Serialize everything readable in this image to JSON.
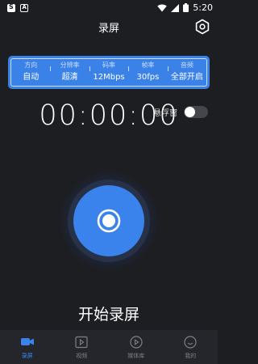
{
  "status_bar": {
    "time": "5:20",
    "left_icons": [
      "app-icon-s",
      "app-icon-a"
    ],
    "right_icons": [
      "wifi-icon",
      "signal-icon",
      "battery-icon"
    ]
  },
  "header": {
    "title": "录屏",
    "settings_icon": "gear-icon"
  },
  "settings_panel": {
    "columns": [
      {
        "label": "方向",
        "value": "自动"
      },
      {
        "label": "分辨率",
        "value": "超清"
      },
      {
        "label": "码率",
        "value": "12Mbps"
      },
      {
        "label": "帧率",
        "value": "30fps"
      },
      {
        "label": "音频",
        "value": "全部开启"
      }
    ],
    "color": "#3a82e8"
  },
  "float_window": {
    "label": "悬浮窗",
    "enabled": false
  },
  "timer": "00:00:00",
  "record": {
    "label": "开始录屏",
    "color": "#3a82ec"
  },
  "bottom_nav": {
    "items": [
      {
        "label": "录屏",
        "icon": "camera-icon",
        "active": true
      },
      {
        "label": "视频",
        "icon": "video-icon",
        "active": false
      },
      {
        "label": "媒体库",
        "icon": "media-library-icon",
        "active": false
      },
      {
        "label": "我的",
        "icon": "profile-icon",
        "active": false
      }
    ]
  }
}
